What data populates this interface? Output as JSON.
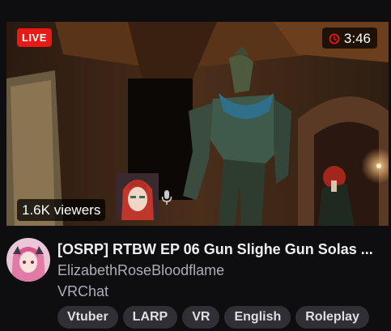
{
  "stream": {
    "live_label": "LIVE",
    "uptime": "3:46",
    "viewers": "1.6K viewers",
    "title": "[OSRP] RTBW EP 06 Gun Slighe Gun Solas ...",
    "channel": "ElizabethRoseBloodflame",
    "category": "VRChat"
  },
  "tags": [
    "Vtuber",
    "LARP",
    "VR",
    "English",
    "Roleplay"
  ],
  "colors": {
    "live": "#e91916",
    "background": "#0e0e10",
    "tag_bg": "#2f2f35",
    "muted_text": "#adadb8"
  },
  "icons": {
    "uptime": "clock-icon",
    "mic": "microphone-icon"
  }
}
